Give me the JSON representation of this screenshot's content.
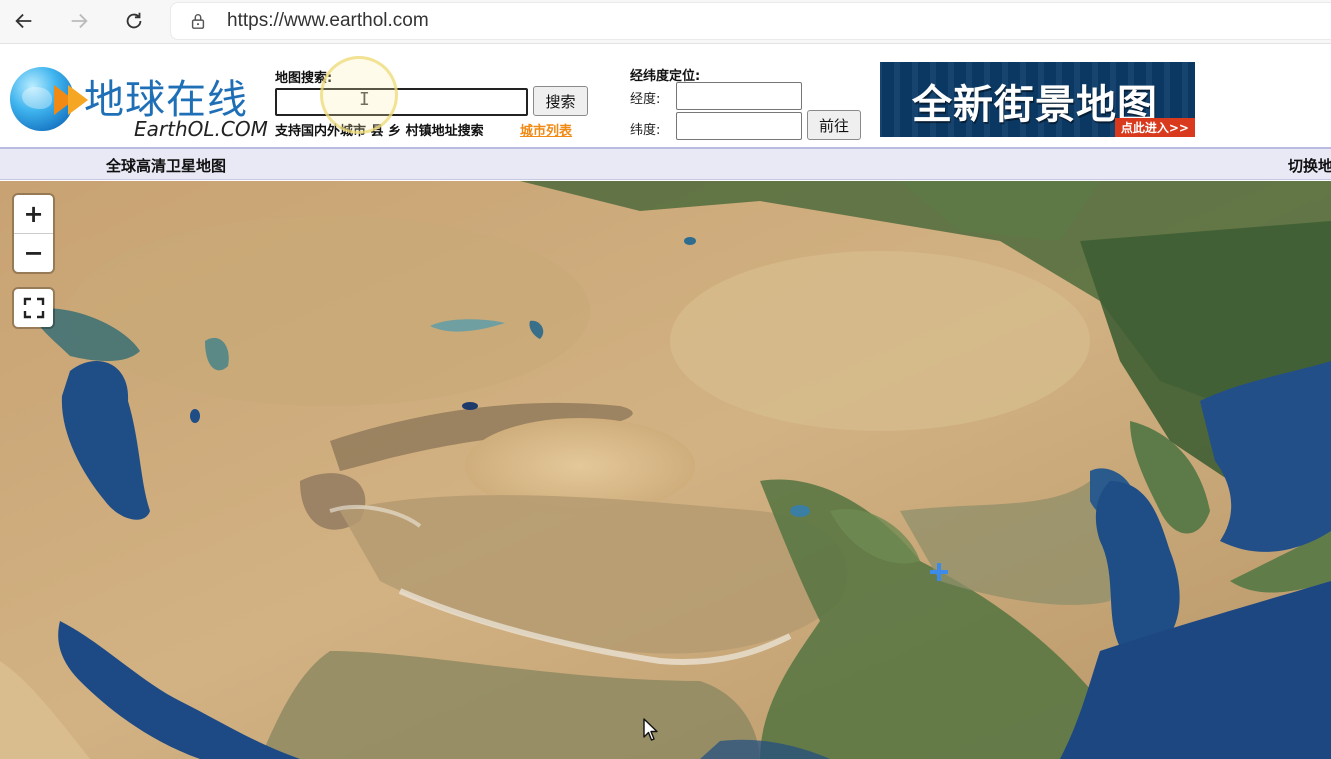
{
  "browser": {
    "url": "https://www.earthol.com"
  },
  "logo": {
    "name_cn": "地球在线",
    "name_en": "EarthOL.COM"
  },
  "search": {
    "label": "地图搜索:",
    "value": "",
    "button": "搜索",
    "hint": "支持国内外城市 县 乡 村镇地址搜索",
    "city_list_link": "城市列表"
  },
  "coords": {
    "title": "经纬度定位:",
    "lon_label": "经度:",
    "lat_label": "纬度:",
    "lon_value": "",
    "lat_value": "",
    "go_button": "前往"
  },
  "banner": {
    "title": "全新街景地图",
    "cta": "点此进入>>"
  },
  "titlebar": {
    "map_title": "全球高清卫星地图",
    "switch_map": "切换地"
  },
  "map_controls": {
    "zoom_in": "+",
    "zoom_out": "−"
  },
  "colors": {
    "accent_orange": "#f08a14",
    "brand_blue": "#1f6fb7",
    "title_bar": "#e8e9f5",
    "marker": "#3d8be8"
  },
  "icons": [
    "back-icon",
    "forward-icon",
    "reload-icon",
    "lock-icon",
    "fullscreen-icon",
    "location-marker-icon",
    "mouse-pointer-icon"
  ]
}
